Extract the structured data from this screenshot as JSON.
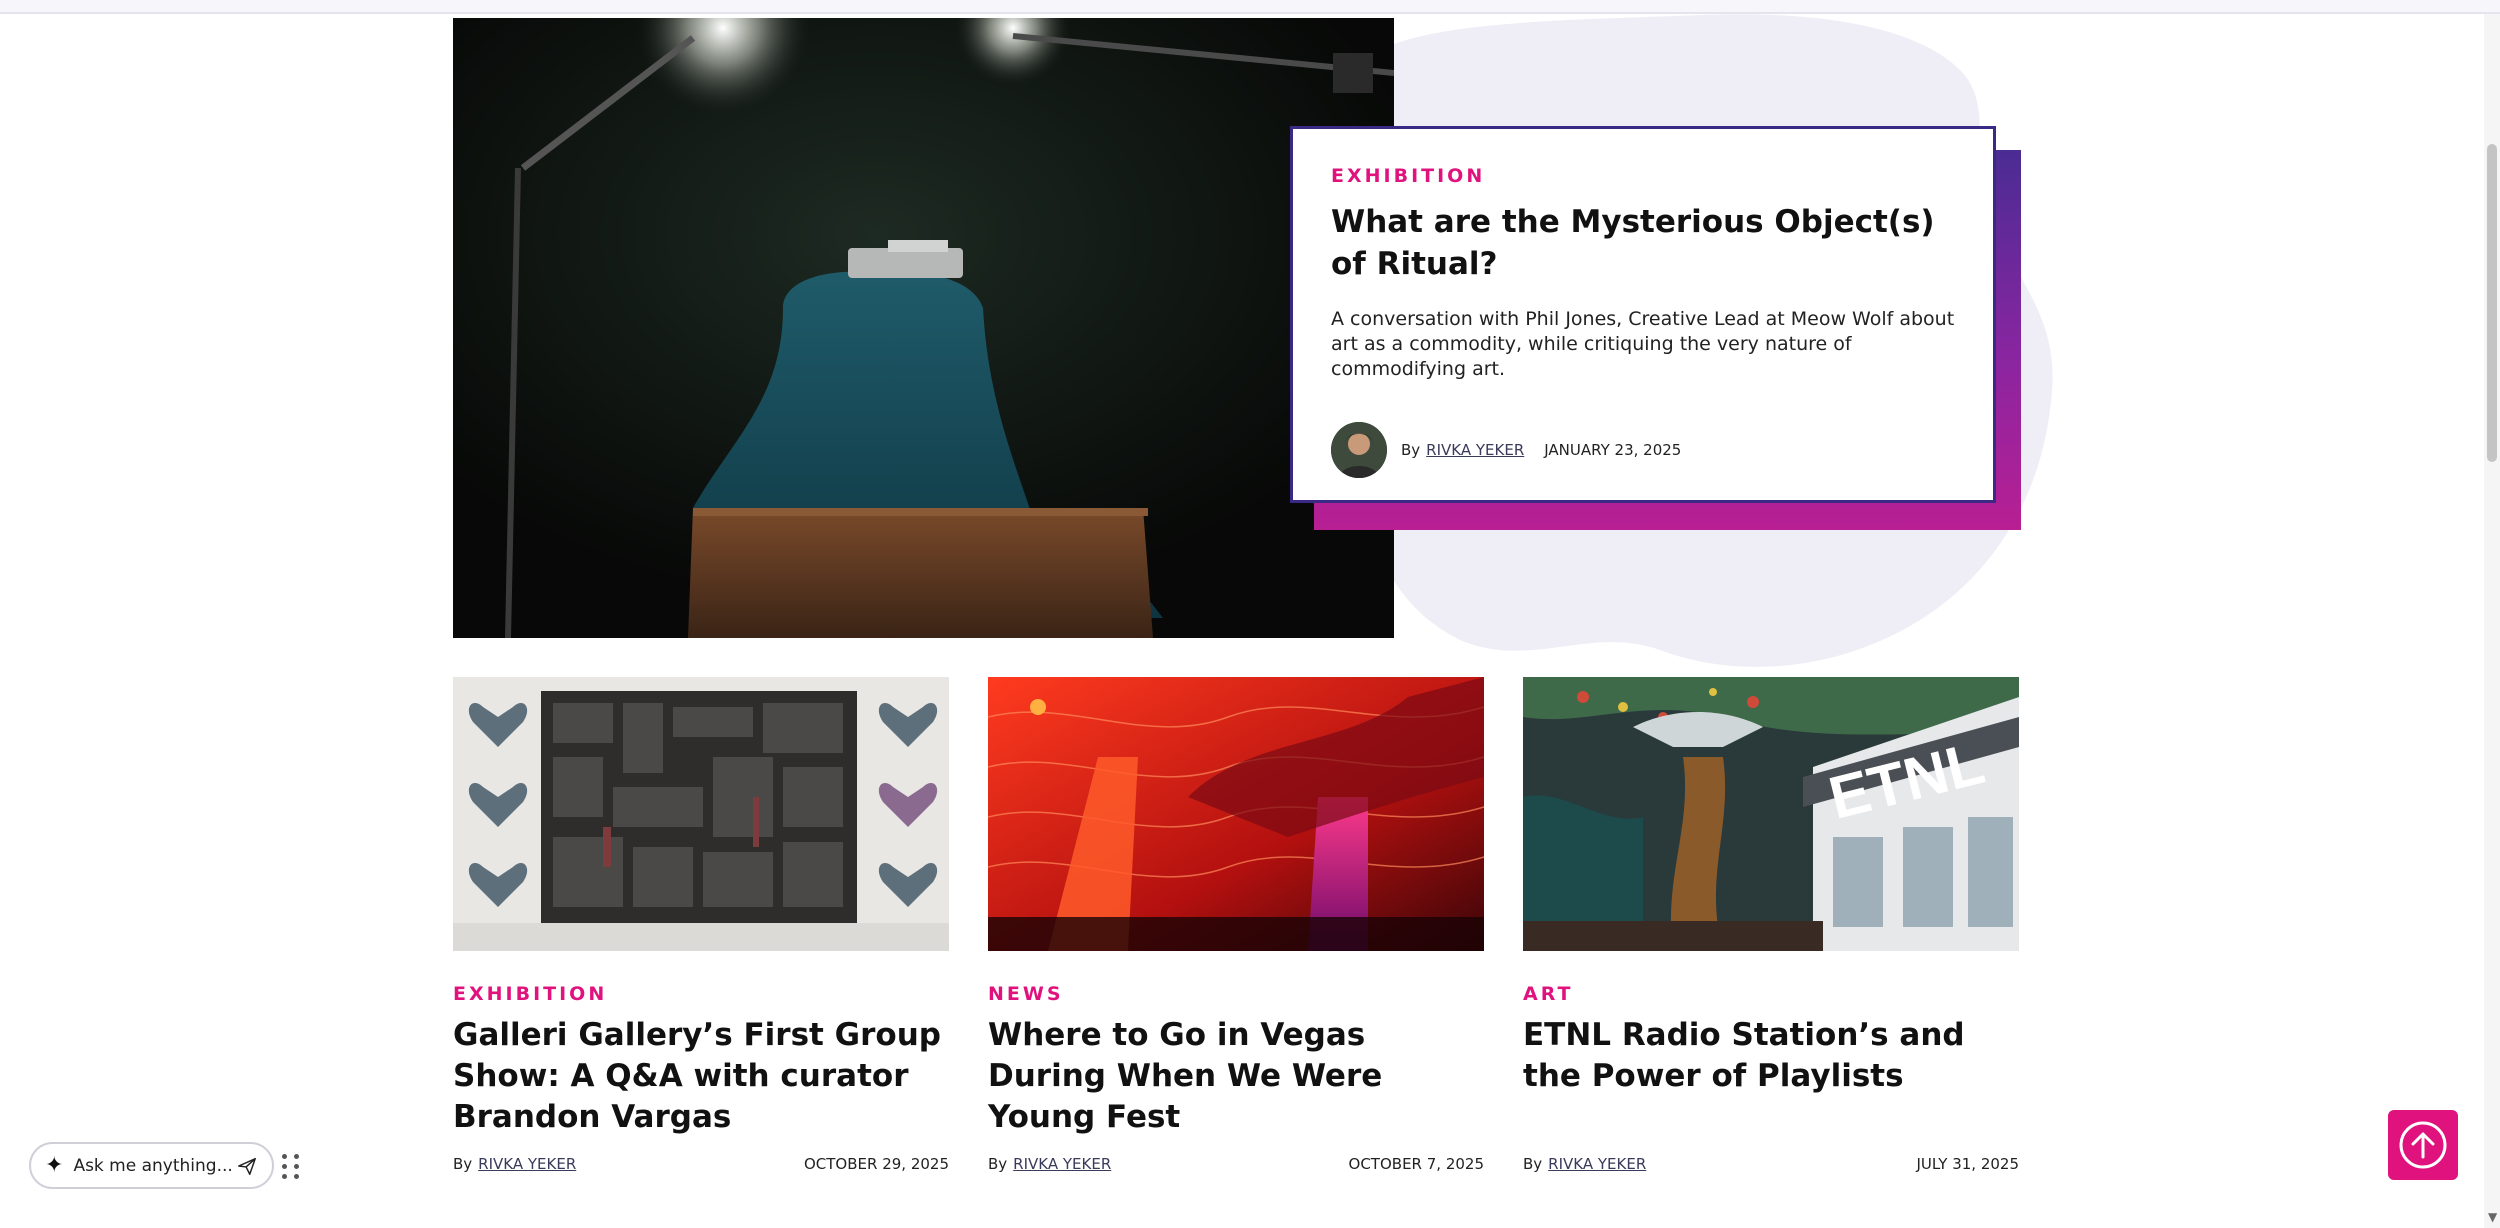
{
  "hero": {
    "category": "EXHIBITION",
    "title": "What are the Mysterious Object(s) of Ritual?",
    "description": "A conversation with Phil Jones, Creative Lead at Meow Wolf about art as a commodity, while critiquing the very nature of commodifying art.",
    "by": "By",
    "author": "RIVKA YEKER",
    "date": "JANUARY 23, 2025"
  },
  "cards": [
    {
      "category": "EXHIBITION",
      "title": "Galleri Gallery’s First Group Show: A Q&A with curator Brandon Vargas",
      "by": "By",
      "author": "RIVKA YEKER",
      "date": "OCTOBER 29, 2025"
    },
    {
      "category": "NEWS",
      "title": "Where to Go in Vegas During When We Were Young Fest",
      "by": "By",
      "author": "RIVKA YEKER",
      "date": "OCTOBER 7, 2025"
    },
    {
      "category": "ART",
      "title": "ETNL Radio Station’s and the Power of Playlists",
      "by": "By",
      "author": "RIVKA YEKER",
      "date": "JULY 31, 2025",
      "sign_text": "ETNL"
    }
  ],
  "assistant": {
    "placeholder": "Ask me anything..."
  },
  "colors": {
    "accent": "#e0137e",
    "card_border": "#3a2a86",
    "gradient_top": "#4a2c93",
    "gradient_bottom": "#b81f93",
    "blob": "#efeef6"
  },
  "icons": {
    "assistant": "sparkle-icon",
    "send": "send-icon",
    "drag": "drag-handle-icon",
    "back_to_top": "arrow-up-circle-icon"
  }
}
